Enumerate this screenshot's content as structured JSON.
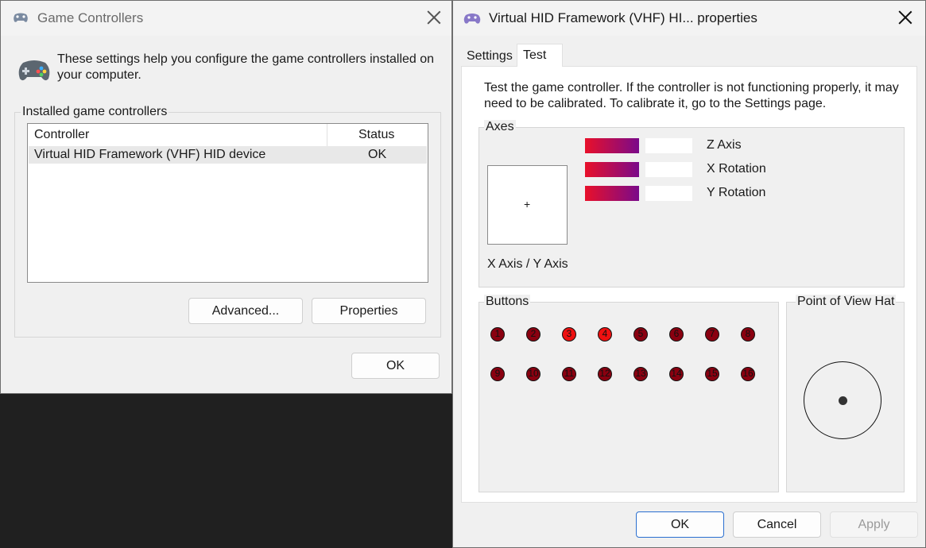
{
  "left_window": {
    "title": "Game Controllers",
    "info_text_line1": "These settings help you configure the game controllers installed on",
    "info_text_line2": "your computer.",
    "group_label": "Installed game controllers",
    "list": {
      "columns": [
        "Controller",
        "Status"
      ],
      "rows": [
        {
          "controller": "Virtual HID Framework (VHF) HID device",
          "status": "OK"
        }
      ]
    },
    "advanced_label": "Advanced...",
    "properties_label": "Properties",
    "ok_label": "OK"
  },
  "right_window": {
    "title": "Virtual HID Framework (VHF) HI... properties",
    "tabs": [
      {
        "label": "Settings",
        "active": false
      },
      {
        "label": "Test",
        "active": true
      }
    ],
    "description_line1": "Test the game controller.  If the controller is not functioning properly, it may",
    "description_line2": "need to be calibrated.  To calibrate it, go to the Settings page.",
    "axes_label": "Axes",
    "xy_label": "X Axis / Y Axis",
    "crosshair": "+",
    "axis_bars": [
      {
        "label": "Z Axis",
        "fill_fraction": 0.5
      },
      {
        "label": "X Rotation",
        "fill_fraction": 0.5
      },
      {
        "label": "Y Rotation",
        "fill_fraction": 0.5
      }
    ],
    "buttons_label": "Buttons",
    "buttons": [
      {
        "n": "1",
        "pressed": false
      },
      {
        "n": "2",
        "pressed": false
      },
      {
        "n": "3",
        "pressed": true
      },
      {
        "n": "4",
        "pressed": true
      },
      {
        "n": "5",
        "pressed": false
      },
      {
        "n": "6",
        "pressed": false
      },
      {
        "n": "7",
        "pressed": false
      },
      {
        "n": "8",
        "pressed": false
      },
      {
        "n": "9",
        "pressed": false
      },
      {
        "n": "10",
        "pressed": false
      },
      {
        "n": "11",
        "pressed": false
      },
      {
        "n": "12",
        "pressed": false
      },
      {
        "n": "13",
        "pressed": false
      },
      {
        "n": "14",
        "pressed": false
      },
      {
        "n": "15",
        "pressed": false
      },
      {
        "n": "16",
        "pressed": false
      }
    ],
    "pov_label": "Point of View Hat",
    "ok_label": "OK",
    "cancel_label": "Cancel",
    "apply_label": "Apply"
  },
  "colors": {
    "accent": "#2a6fd0",
    "bar_start": "#e8102a",
    "bar_end": "#7a0a8a",
    "button_off": "#8a0010",
    "button_on": "#ee1010"
  }
}
